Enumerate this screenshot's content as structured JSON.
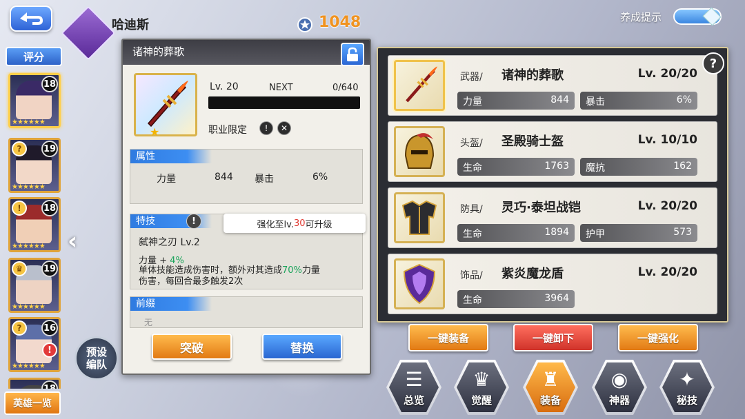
{
  "header": {
    "hero_name": "哈迪斯",
    "rating": "1048",
    "hint_label": "养成提示"
  },
  "left": {
    "score_label": "评分",
    "hero_list_label": "英雄一览",
    "preset_label_line1": "预设",
    "preset_label_line2": "编队",
    "heroes": [
      {
        "level": "18",
        "stars": "★★★★★★",
        "badge": "",
        "alert": "",
        "hair": "#3a2a66",
        "skin": "#f1d4c4"
      },
      {
        "level": "19",
        "stars": "★★★★★★",
        "badge": "?",
        "alert": "",
        "hair": "#1f1a2a",
        "skin": "#f2d8c8"
      },
      {
        "level": "18",
        "stars": "★★★★★★",
        "badge": "!",
        "alert": "",
        "hair": "#9b2b2b",
        "skin": "#f0cfb6"
      },
      {
        "level": "19",
        "stars": "★★★★★★",
        "badge": "♛",
        "alert": "",
        "hair": "#b9bfcc",
        "skin": "#eed3c3"
      },
      {
        "level": "16",
        "stars": "★★★★★★",
        "badge": "?",
        "alert": "!",
        "hair": "#5d6fa8",
        "skin": "#f2d9cd"
      },
      {
        "level": "18",
        "stars": "",
        "badge": "",
        "alert": "",
        "hair": "#444",
        "skin": "#ccc"
      }
    ]
  },
  "detail": {
    "title": "诸神的葬歌",
    "level": "Lv. 20",
    "next_label": "NEXT",
    "exp": "0/640",
    "exp_fraction": 0,
    "job_label": "职业限定",
    "job_icons": [
      "!",
      "✕"
    ],
    "attr_title": "属性",
    "attr": [
      {
        "k": "力量",
        "v": "844"
      },
      {
        "k": "暴击",
        "v": "6%"
      }
    ],
    "skill_title": "特技",
    "skill_tooltip_pre": "强化至lv.",
    "skill_tooltip_num": "30",
    "skill_tooltip_post": "可升级",
    "skill_name": "弑神之刃  Lv.2",
    "skill_bonus_key": "力量 + ",
    "skill_bonus_val": "4%",
    "skill_desc_a": "单体技能造成伤害时，额外对其造成",
    "skill_desc_pct": "70%",
    "skill_desc_b": "力量",
    "skill_desc_c": "伤害，每回合最多触发2次",
    "prefix_title": "前缀",
    "prefix_value": "无",
    "break_label": "突破",
    "swap_label": "替换"
  },
  "equipment": [
    {
      "type": "武器/",
      "name": "诸神的葬歌",
      "level": "Lv. 20/20",
      "stats": [
        {
          "k": "力量",
          "v": "844"
        },
        {
          "k": "暴击",
          "v": "6%"
        }
      ]
    },
    {
      "type": "头盔/",
      "name": "圣殿骑士盔",
      "level": "Lv. 10/10",
      "stats": [
        {
          "k": "生命",
          "v": "1763"
        },
        {
          "k": "魔抗",
          "v": "162"
        }
      ]
    },
    {
      "type": "防具/",
      "name": "灵巧·泰坦战铠",
      "level": "Lv. 20/20",
      "stats": [
        {
          "k": "生命",
          "v": "1894"
        },
        {
          "k": "护甲",
          "v": "573"
        }
      ]
    },
    {
      "type": "饰品/",
      "name": "紫炎魔龙盾",
      "level": "Lv. 20/20",
      "stats": [
        {
          "k": "生命",
          "v": "3964"
        }
      ]
    }
  ],
  "actions": {
    "equip_all": "一键装备",
    "unequip_all": "一键卸下",
    "enhance_all": "一键强化"
  },
  "tabs": [
    {
      "label": "总览",
      "icon": "document-icon",
      "glyph": "☰"
    },
    {
      "label": "觉醒",
      "icon": "crest-icon",
      "glyph": "♛"
    },
    {
      "label": "装备",
      "icon": "armor-icon",
      "glyph": "♜"
    },
    {
      "label": "神器",
      "icon": "orb-icon",
      "glyph": "◉"
    },
    {
      "label": "秘技",
      "icon": "book-icon",
      "glyph": "✦"
    }
  ],
  "active_tab": 2,
  "colors": {
    "accent_orange": "#e27a14",
    "accent_blue": "#2b67d4",
    "highlight_green": "#1aa35a",
    "highlight_red": "#e0372f"
  }
}
